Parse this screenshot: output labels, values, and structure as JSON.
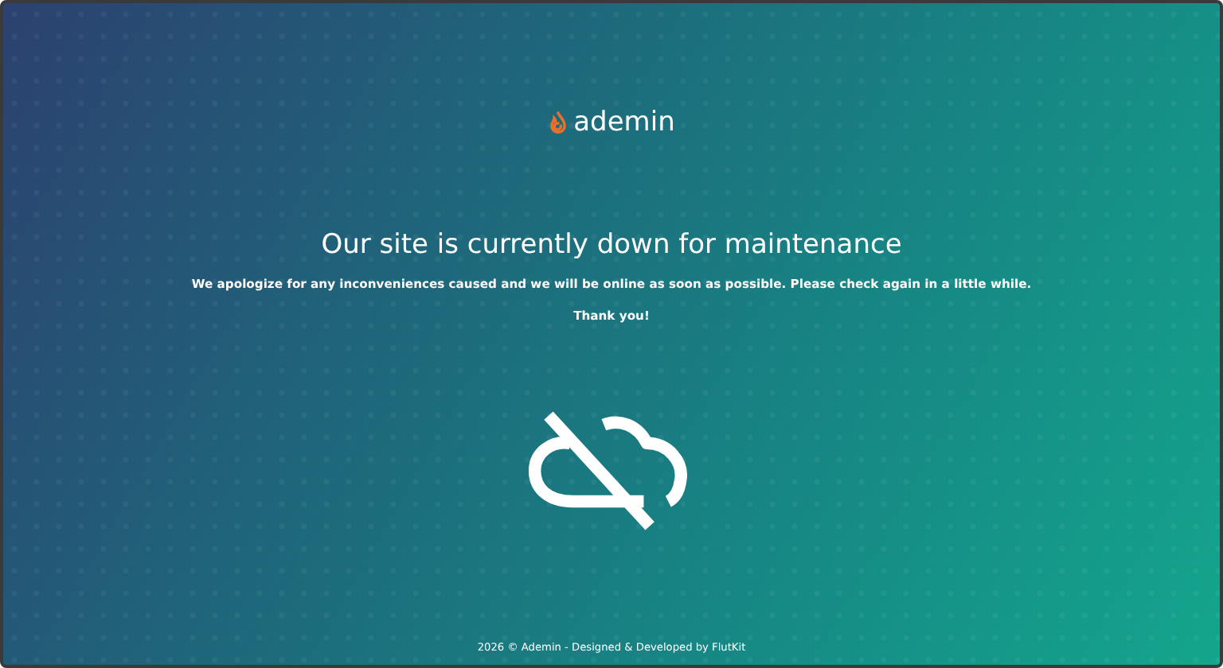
{
  "logo": {
    "text": "ademin"
  },
  "heading": "Our site is currently down for maintenance",
  "message": "We apologize for any inconveniences caused and we will be online as soon as possible. Please check again in a little while.",
  "thanks": "Thank you!",
  "footer": "2026 © Ademin - Designed & Developed by FlutKit"
}
